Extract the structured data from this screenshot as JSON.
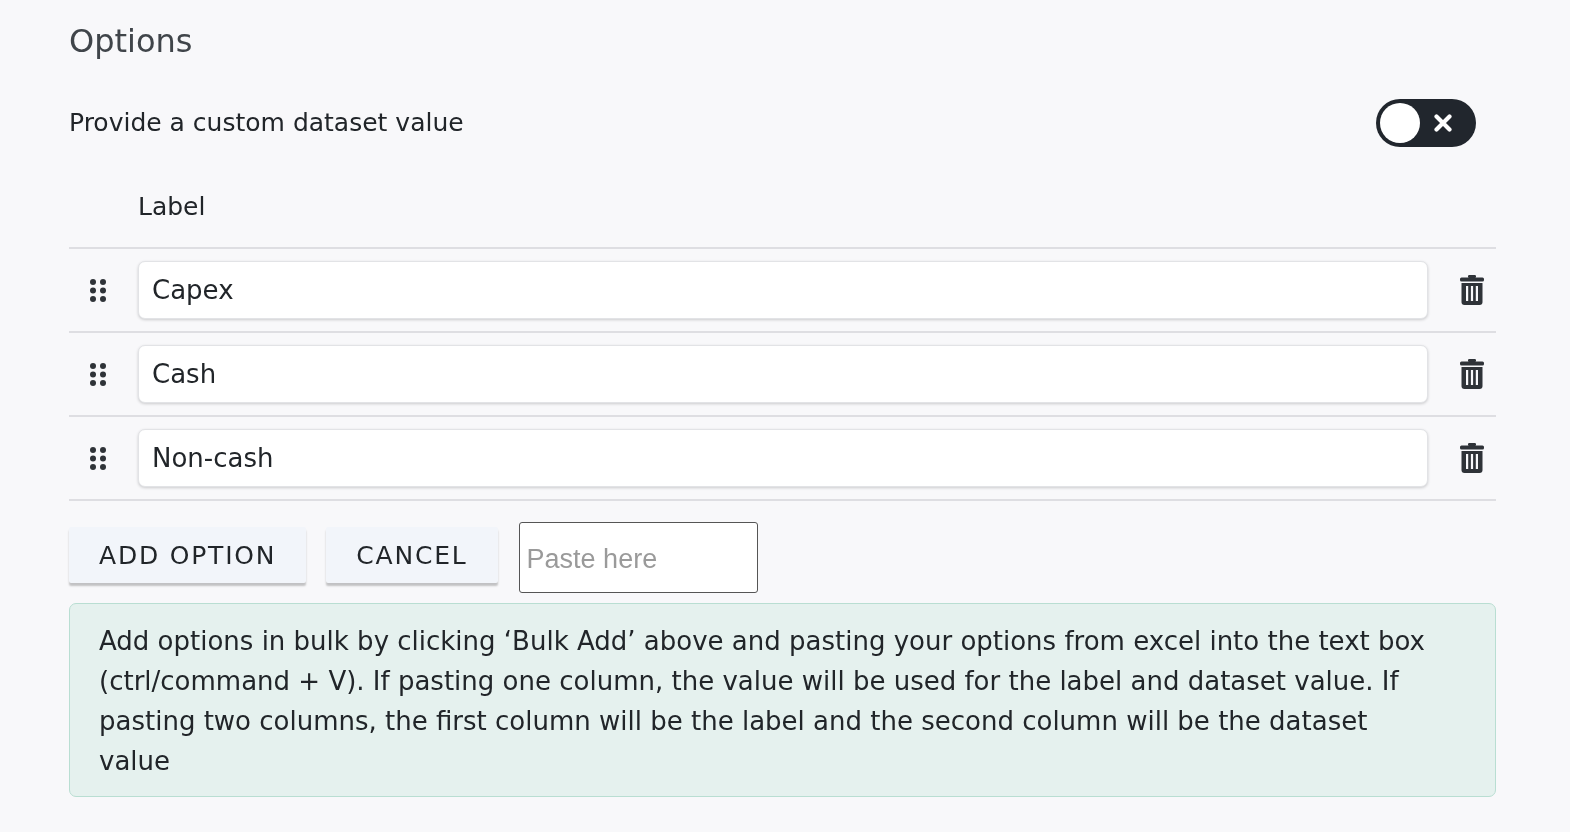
{
  "heading": "Options",
  "custom_value": {
    "label": "Provide a custom dataset value",
    "on": false
  },
  "table": {
    "columns": [
      "Label"
    ],
    "rows": [
      {
        "value": "Capex"
      },
      {
        "value": "Cash"
      },
      {
        "value": "Non-cash"
      }
    ]
  },
  "buttons": [
    "ADD OPTION",
    "CANCEL"
  ],
  "paste_field": {
    "placeholder": "Paste here"
  },
  "info": "Add options in bulk by clicking ‘Bulk Add’ above and pasting your options from excel into the text box (ctrl/command + V). If pasting one column, the value will be used for the label and dataset value. If pasting two columns, the first column will be the label and the second column will be the dataset value"
}
